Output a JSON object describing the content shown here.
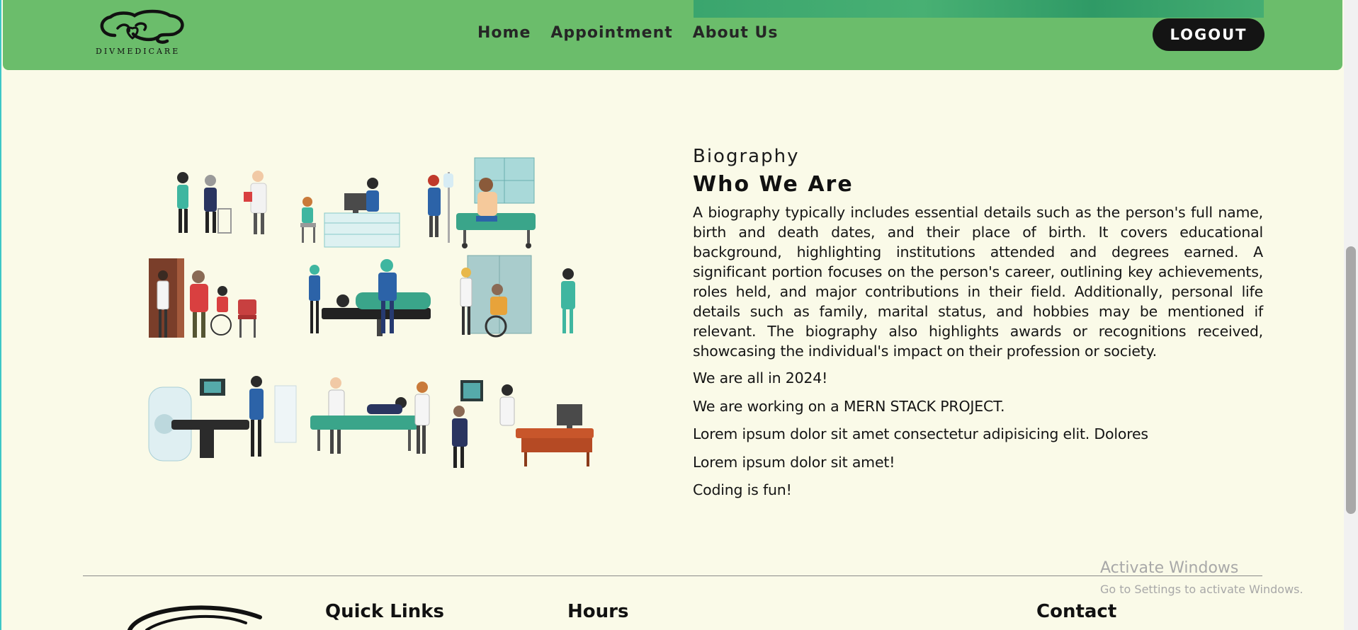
{
  "header": {
    "logo_text": "DIVMEDICARE",
    "nav": [
      {
        "label": "Home"
      },
      {
        "label": "Appointment"
      },
      {
        "label": "About Us"
      }
    ],
    "logout_label": "LOGOUT"
  },
  "bio": {
    "kicker": "Biography",
    "title": "Who We Are",
    "paragraph": "A biography typically includes essential details such as the person's full name, birth and death dates, and their place of birth. It covers educational background, highlighting institutions attended and degrees earned. A significant portion focuses on the person's career, outlining key achievements, roles held, and major contributions in their field. Additionally, personal life details such as family, marital status, and hobbies may be mentioned if relevant. The biography also highlights awards or recognitions received, showcasing the individual's impact on their profession or society.",
    "lines": [
      "We are all in 2024!",
      "We are working on a MERN STACK PROJECT.",
      "Lorem ipsum dolor sit amet consectetur adipisicing elit. Dolores",
      "Lorem ipsum dolor sit amet!",
      "Coding is fun!"
    ]
  },
  "footer": {
    "quick_links_heading": "Quick Links",
    "hours_heading": "Hours",
    "contact_heading": "Contact"
  },
  "watermark": {
    "title": "Activate Windows",
    "subtitle": "Go to Settings to activate Windows."
  },
  "colors": {
    "navbar": "#6bbd6b",
    "background": "#fafae8",
    "logout_bg": "#141414",
    "scrubs_teal": "#3fb6a0",
    "bed_green": "#3aa58a"
  }
}
